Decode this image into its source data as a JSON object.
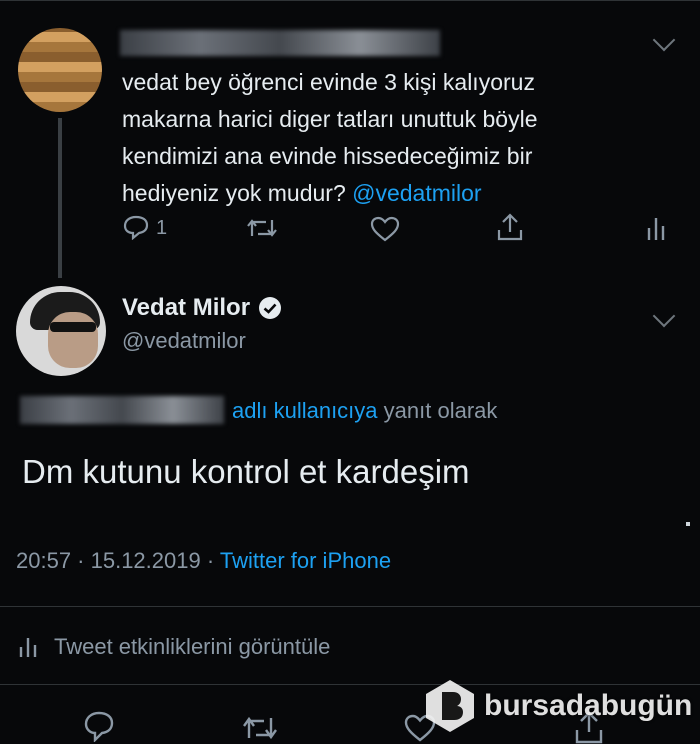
{
  "reply_tweet": {
    "body_text": "vedat bey öğrenci evinde 3 kişi kalıyoruz makarna harici diger tatları unuttuk böyle kendimizi ana evinde hissedeceğimiz bir hediyeniz yok mudur?",
    "mention": "@vedatmilor",
    "reply_count": "1"
  },
  "main_tweet": {
    "display_name": "Vedat Milor",
    "handle": "@vedatmilor",
    "reply_context_link": "adlı kullanıcıya",
    "reply_context_suffix": "yanıt olarak",
    "body_text": "Dm kutunu kontrol et kardeşim",
    "timestamp": "20:57 · 15.12.2019 ·",
    "source": "Twitter for iPhone",
    "activity_label": "Tweet etkinliklerini görüntüle"
  },
  "watermark": {
    "text": "bursadabugün"
  },
  "colors": {
    "background": "#07080a",
    "text": "#e6ecf0",
    "secondary": "#8b98a5",
    "link": "#1da1f2",
    "verified": "#e6ecf0"
  }
}
